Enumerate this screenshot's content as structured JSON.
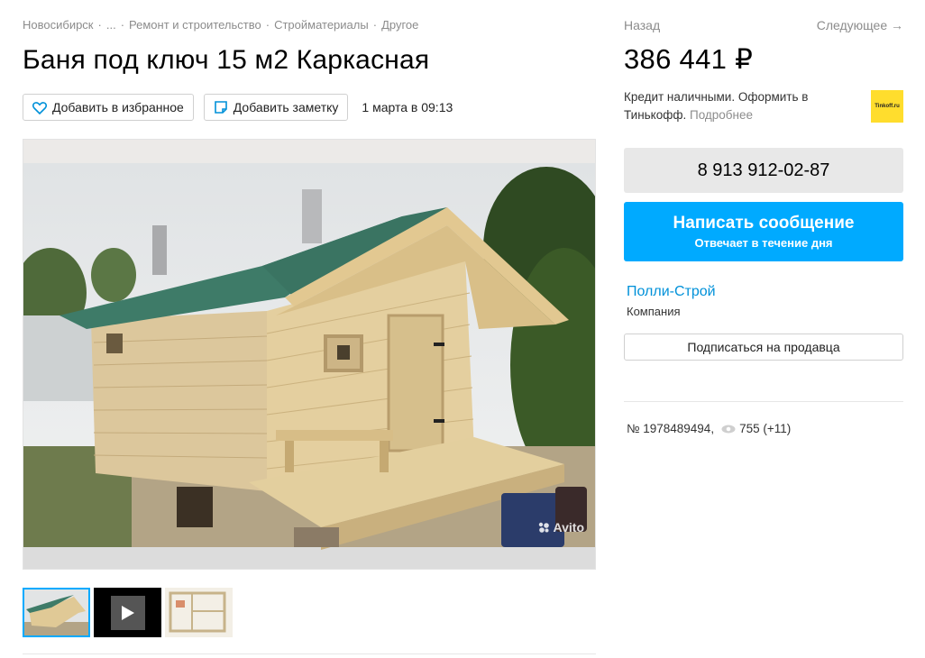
{
  "breadcrumbs": [
    "Новосибирск",
    "...",
    "Ремонт и строительство",
    "Стройматериалы",
    "Другое"
  ],
  "title": "Баня под ключ 15 м2 Каркасная",
  "actions": {
    "favorite_label": "Добавить в избранное",
    "note_label": "Добавить заметку",
    "date": "1 марта в 09:13"
  },
  "gallery": {
    "watermark": "Avito",
    "thumbnails": [
      "photo",
      "video",
      "plan"
    ]
  },
  "nav": {
    "back": "Назад",
    "next": "Следующее →"
  },
  "price": "386 441 ₽",
  "credit": {
    "text": "Кредит наличными. Оформить в Тинькофф.",
    "more": "Подробнее",
    "logo_text": "Tinkoff.ru"
  },
  "phone": "8 913 912-02-87",
  "message": {
    "main": "Написать сообщение",
    "sub": "Отвечает в течение дня"
  },
  "seller": {
    "name": "Полли-Строй",
    "type": "Компания",
    "subscribe_label": "Подписаться на продавца"
  },
  "meta": {
    "id": "№ 1978489494,",
    "views": "755 (+11)"
  },
  "colors": {
    "accent": "#00aaff",
    "link": "#0091d9",
    "tinkoff": "#ffdd2d"
  },
  "icons": [
    "heart-icon",
    "note-icon",
    "eye-icon",
    "play-icon",
    "avito-dots-icon"
  ]
}
